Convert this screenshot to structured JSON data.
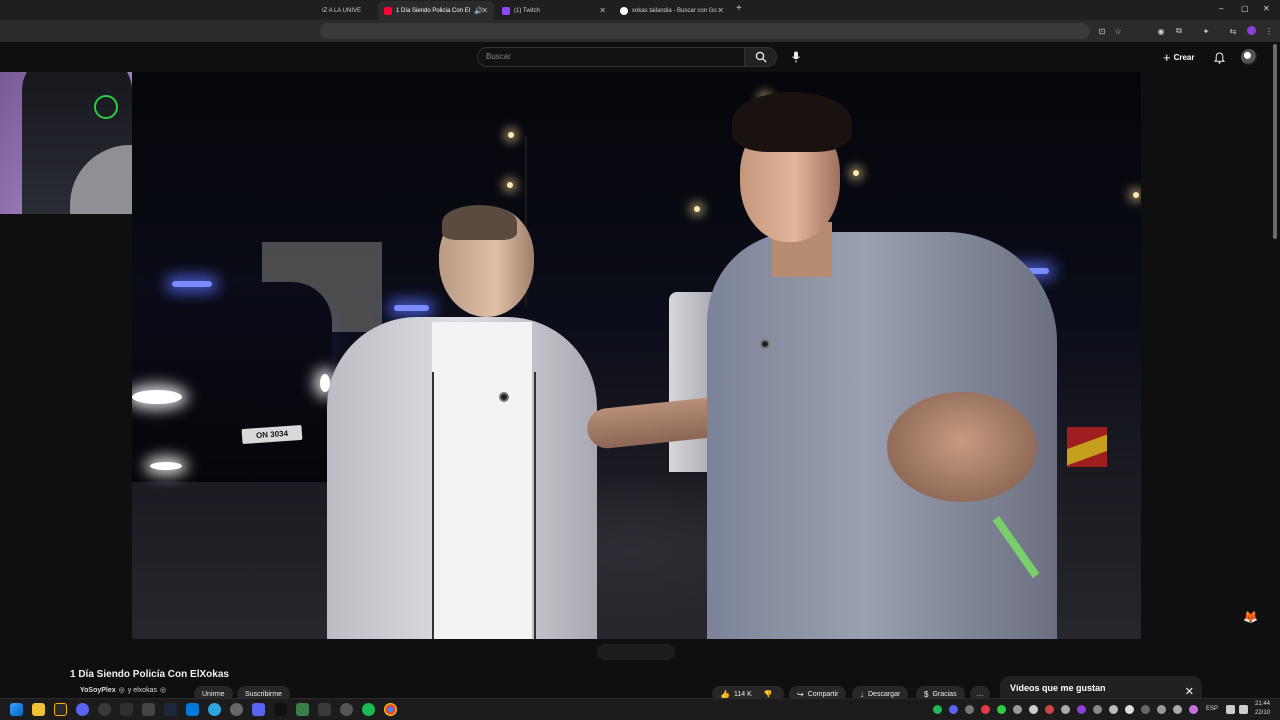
{
  "browser": {
    "tabs": [
      {
        "label": "IZ A LA UNIVE",
        "active": false
      },
      {
        "label": "1 Día Siendo Policía Con El",
        "active": true
      },
      {
        "label": "(1) Twitch",
        "active": false
      },
      {
        "label": "xokas tailandia - Buscar con Go",
        "active": false
      }
    ],
    "new_tab_symbol": "+",
    "window_controls": [
      "–",
      "▢",
      "✕"
    ]
  },
  "youtube": {
    "search_placeholder": "Buscar",
    "create_label": "Crear",
    "video_title": "1 Día Siendo Policía Con ElXokas",
    "channel_name": "YoSoyPlex",
    "collab_name": "y elxokas",
    "join_label": "Unirme",
    "subscribe_label": "Suscribirme",
    "likes": "114 K",
    "share_label": "Compartir",
    "download_label": "Descargar",
    "thanks_label": "Gracias",
    "more_label": "…",
    "liked_panel_title": "Vídeos que me gustan"
  },
  "video_scene": {
    "plate_text": "ON 3034"
  },
  "taskbar": {
    "language": "ESP",
    "time": "21:44",
    "date": "22/10"
  },
  "colors": {
    "accent_purple": "#8e3fd8",
    "youtube_bg": "#0f0f0f",
    "youtube_red": "#ff0033"
  }
}
